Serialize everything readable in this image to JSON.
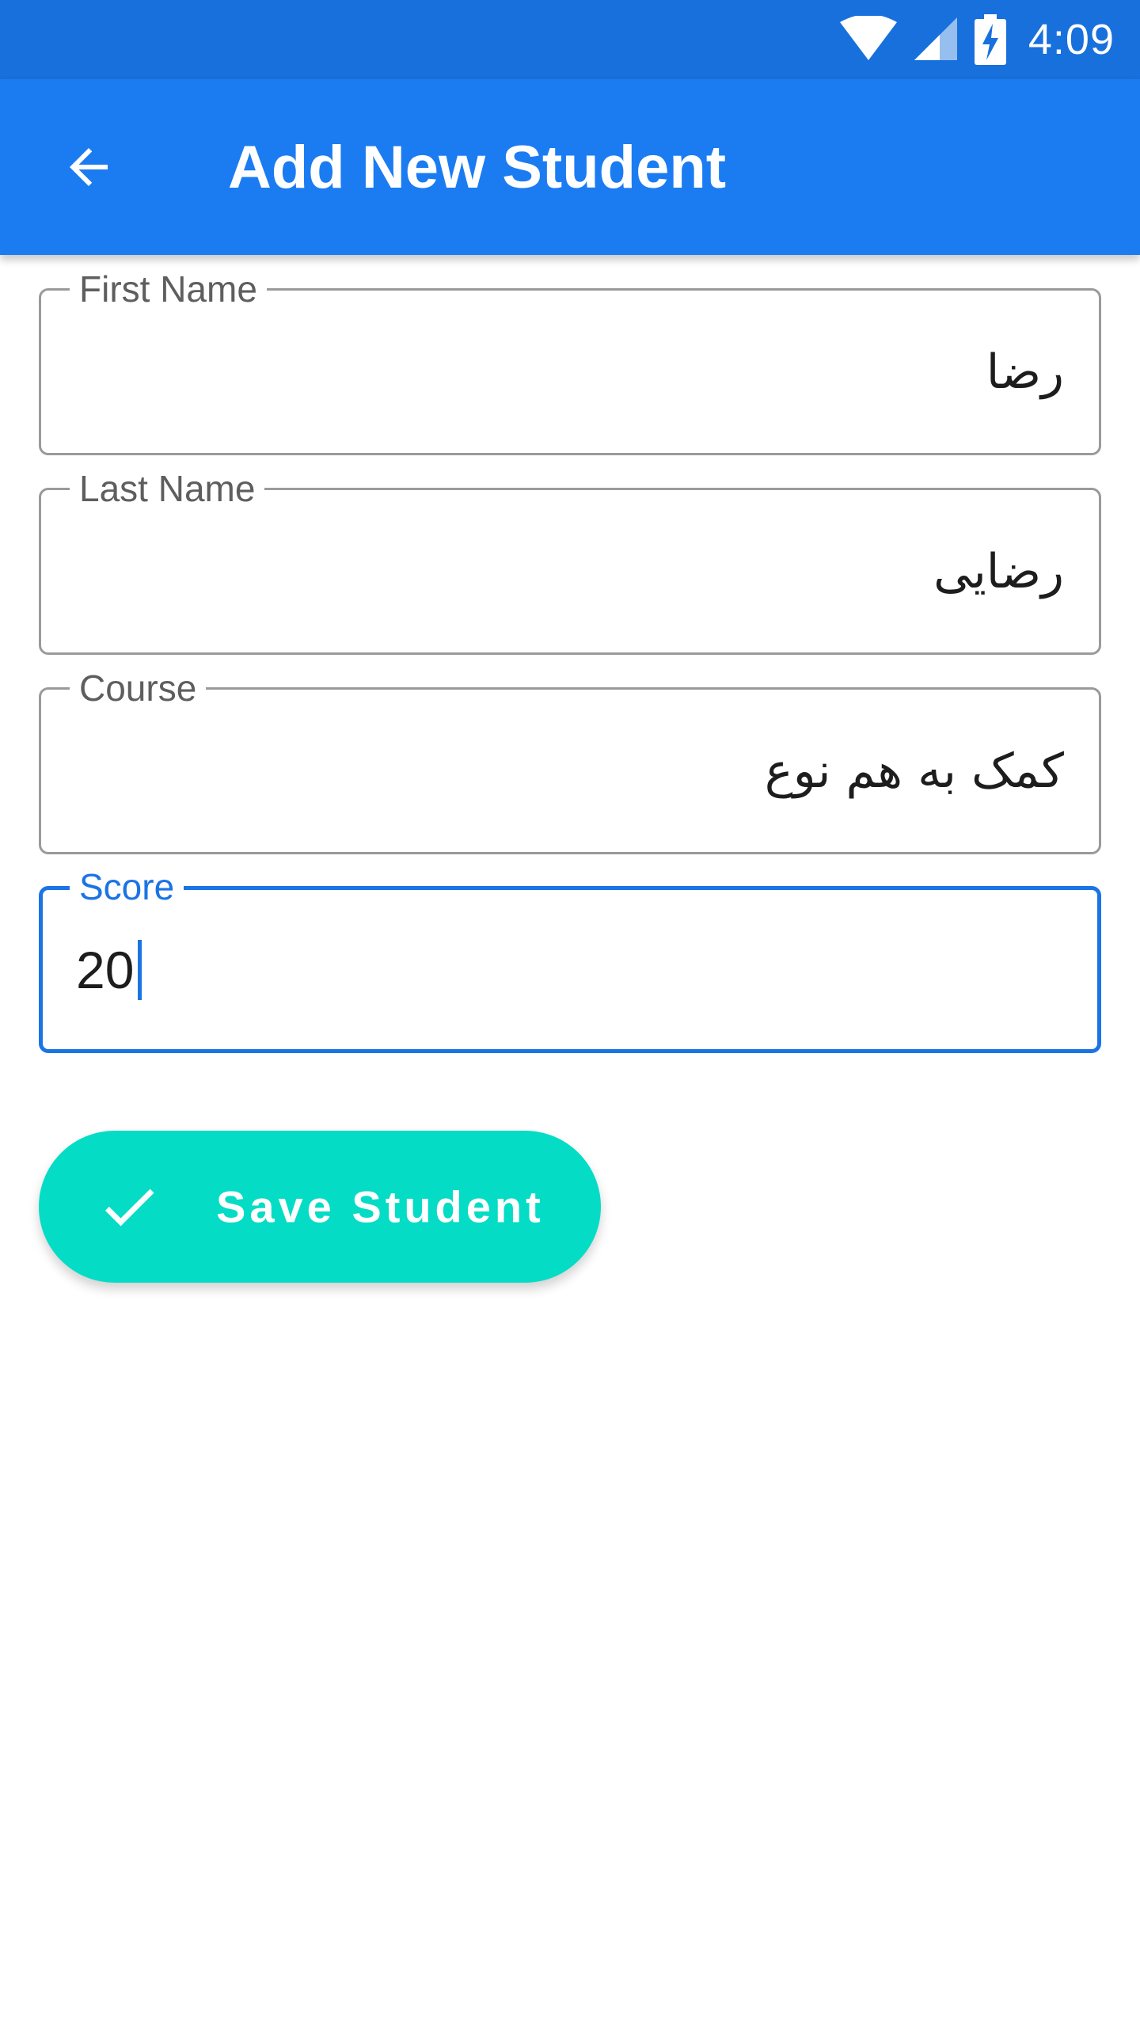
{
  "status_bar": {
    "time": "4:09",
    "icons": [
      "wifi-icon",
      "cellular-signal-icon",
      "battery-charging-icon"
    ]
  },
  "app_bar": {
    "title": "Add New Student",
    "back_icon": "arrow-back-icon"
  },
  "form": {
    "first_name": {
      "label": "First Name",
      "value": "رضا"
    },
    "last_name": {
      "label": "Last Name",
      "value": "رضایی"
    },
    "course": {
      "label": "Course",
      "value": "کمک به هم نوع"
    },
    "score": {
      "label": "Score",
      "value": "20",
      "focused": true
    }
  },
  "save_button": {
    "label": "Save Student",
    "icon": "check-icon"
  },
  "colors": {
    "status_bar": "#1870dc",
    "app_bar": "#1b7cf2",
    "focus": "#1b74e4",
    "fab": "#05dcc5"
  }
}
